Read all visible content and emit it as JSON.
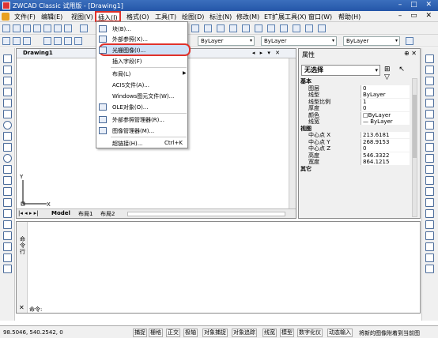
{
  "title": "ZWCAD Classic 试用版 - [Drawing1]",
  "menu": [
    "文件(F)",
    "编辑(E)",
    "视图(V)",
    "插入(I)",
    "格式(O)",
    "工具(T)",
    "绘图(D)",
    "标注(N)",
    "修改(M)",
    "ET扩展工具(X)",
    "窗口(W)",
    "帮助(H)"
  ],
  "toolbar": {
    "color_combo": "ByLayer",
    "linetype_combo": "ByLayer",
    "lineweight_combo": "ByLayer"
  },
  "insert_menu": {
    "items": [
      "块(B)...",
      "外部参照(X)...",
      "光栅图像(I)...",
      "插入字段(F)",
      "布局(L)",
      "ACIS文件(A)...",
      "Windows图元文件(W)...",
      "OLE对象(O)...",
      "外部参照管理器(R)...",
      "图像管理器(M)...",
      "超链接(H)..."
    ],
    "shortcut": "Ctrl+K"
  },
  "drawing": {
    "tab": "Drawing1",
    "tab_controls": "◂ ▸ ▾ ✕",
    "axis_y": "Y",
    "axis_x": "X",
    "layout_tabs": [
      "Model",
      "布局1",
      "布局2"
    ]
  },
  "properties": {
    "title": "属性",
    "selection": "无选择",
    "rows": [
      {
        "cat": true,
        "k": "基本"
      },
      {
        "k": "图层",
        "v": "0"
      },
      {
        "k": "线型",
        "v": "ByLayer"
      },
      {
        "k": "线型比例",
        "v": "1"
      },
      {
        "k": "厚度",
        "v": "0"
      },
      {
        "k": "颜色",
        "v": "□ByLayer"
      },
      {
        "k": "线宽",
        "v": "— ByLayer"
      },
      {
        "cat": true,
        "k": "视图"
      },
      {
        "k": "中心点 X",
        "v": "213.6181"
      },
      {
        "k": "中心点 Y",
        "v": "268.9153"
      },
      {
        "k": "中心点 Z",
        "v": "0"
      },
      {
        "k": "高度",
        "v": "546.3322"
      },
      {
        "k": "宽度",
        "v": "864.1215"
      },
      {
        "cat": true,
        "k": "其它"
      }
    ]
  },
  "command": {
    "side_label": "命令行",
    "prompt": "命令:"
  },
  "status": {
    "coords": "98.5046,  540.2542,  0",
    "buttons": [
      "捕捉",
      "栅格",
      "正交",
      "极轴",
      "对象捕捉",
      "对象追踪",
      "线宽",
      "模型",
      "数字化仪",
      "动态输入",
      "将新的图像附着到当前图"
    ]
  }
}
